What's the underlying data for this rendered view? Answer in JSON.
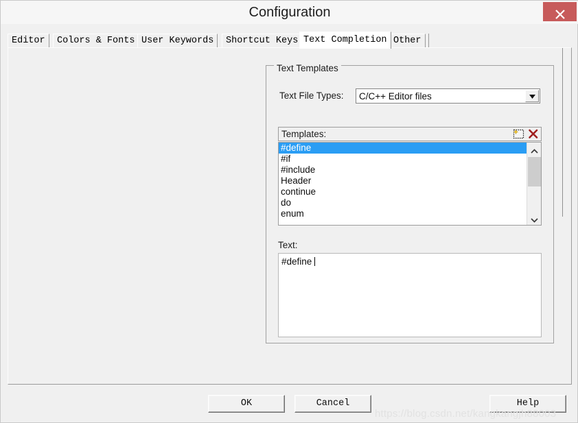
{
  "window": {
    "title": "Configuration",
    "close_icon": "close-x-icon"
  },
  "tabs": [
    {
      "label": "Editor",
      "active": false
    },
    {
      "label": "Colors & Fonts",
      "active": false
    },
    {
      "label": "User Keywords",
      "active": false
    },
    {
      "label": "Shortcut Keys",
      "active": false
    },
    {
      "label": "Text Completion",
      "active": true
    },
    {
      "label": "Other",
      "active": false
    }
  ],
  "group": {
    "legend": "Text Templates",
    "file_types": {
      "label": "Text File Types:",
      "selected": "C/C++ Editor files",
      "arrow_icon": "chevron-down-icon"
    },
    "templates": {
      "header_label": "Templates:",
      "new_icon": "new-template-icon",
      "delete_icon": "delete-red-x-icon",
      "items": [
        "#define",
        "#if",
        "#include",
        "Header",
        "continue",
        "do",
        "enum"
      ],
      "selected_index": 0,
      "scroll_up_icon": "chevron-up-icon",
      "scroll_down_icon": "chevron-down-icon"
    },
    "text": {
      "label": "Text:",
      "value": "#define "
    }
  },
  "buttons": {
    "ok": "OK",
    "cancel": "Cancel",
    "help": "Help"
  },
  "watermark": {
    "text": "https://blog.csdn.net/kangkangjh88003"
  },
  "colors": {
    "selection": "#2a9df4",
    "close_button": "#c75b5b",
    "dialog_face": "#f0f0f0",
    "delete_icon": "#a02020"
  }
}
